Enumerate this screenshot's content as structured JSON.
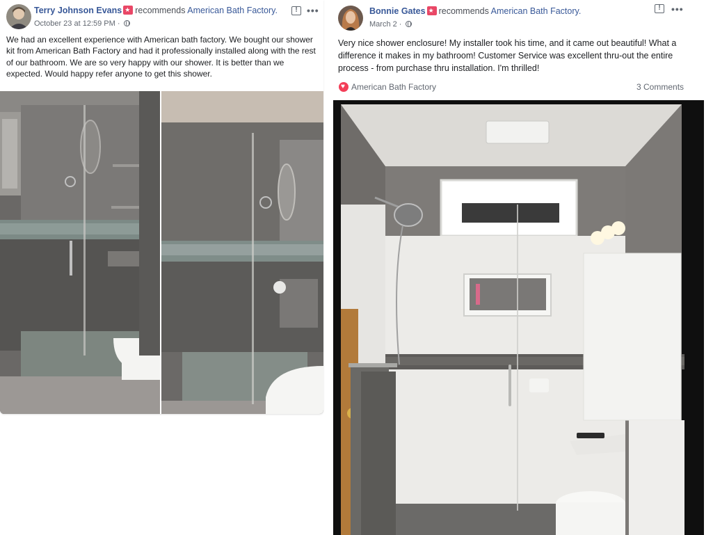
{
  "posts": [
    {
      "author": "Terry Johnson Evans",
      "recommends": "recommends",
      "page": "American Bath Factory.",
      "date": "October 23 at 12:59 PM ·",
      "text": "We had an excellent experience with American bath factory. We bought our shower kit from American Bath Factory and had it professionally installed along with the rest of our bathroom. We are so very happy with our shower. It is better than we expected. Would happy refer anyone to get this shower."
    },
    {
      "author": "Bonnie Gates",
      "recommends": "recommends",
      "page": "American Bath Factory.",
      "date": "March 2 ·",
      "text": "Very nice shower enclosure! My installer took his time, and it came out beautiful! What a difference it makes in my bathroom! Customer Service was excellent thru-out the entire process - from purchase thru installation. I'm thrilled!",
      "reaction_name": "American Bath Factory",
      "comments": "3 Comments"
    }
  ],
  "icons": {
    "recommend_badge": "recommend-badge-icon",
    "globe": "globe-icon",
    "report": "report-icon",
    "more": "more-options-icon",
    "love": "love-reaction-icon"
  },
  "colors": {
    "link": "#385898",
    "recommend_badge": "#e94766",
    "love": "#f33e58",
    "meta_text": "#616770"
  }
}
